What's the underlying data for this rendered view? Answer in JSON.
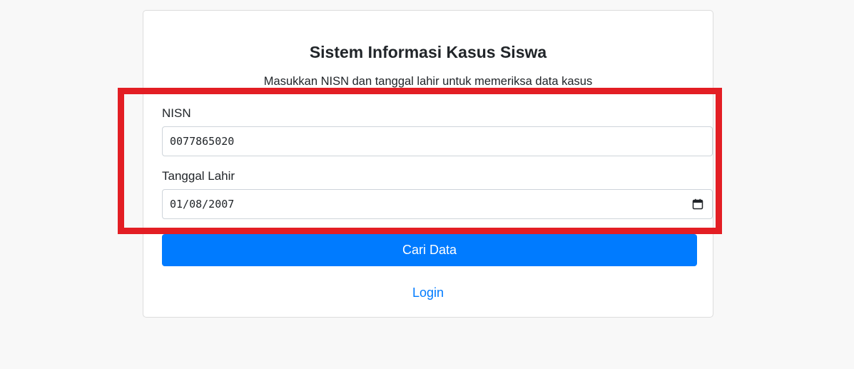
{
  "form": {
    "title": "Sistem Informasi Kasus Siswa",
    "subtitle": "Masukkan NISN dan tanggal lahir untuk memeriksa data kasus",
    "nisn_label": "NISN",
    "nisn_value": "0077865020",
    "tanggal_lahir_label": "Tanggal Lahir",
    "tanggal_lahir_value": "01/08/2007",
    "submit_label": "Cari Data",
    "login_link": "Login"
  },
  "colors": {
    "page_background": "#f8f8f8",
    "primary": "#007bff",
    "highlight": "#e31e24"
  },
  "icons": {
    "date_picker": "calendar-icon"
  }
}
